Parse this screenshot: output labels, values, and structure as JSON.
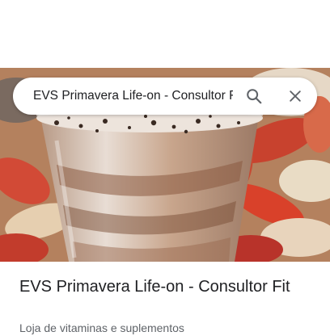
{
  "search": {
    "query": "EVS Primavera Life-on - Consultor Fit",
    "search_icon": "search-icon",
    "close_icon": "close-icon"
  },
  "hero": {
    "image": "photo of dessert cup with cookie crumbs on a bed of red and cream leaves"
  },
  "place": {
    "title": "EVS Primavera Life-on - Consultor Fit",
    "category": "Loja de vitaminas e suplementos"
  },
  "colors": {
    "text_primary": "#202124",
    "text_secondary": "#5f6368",
    "icon": "#5f6368"
  }
}
